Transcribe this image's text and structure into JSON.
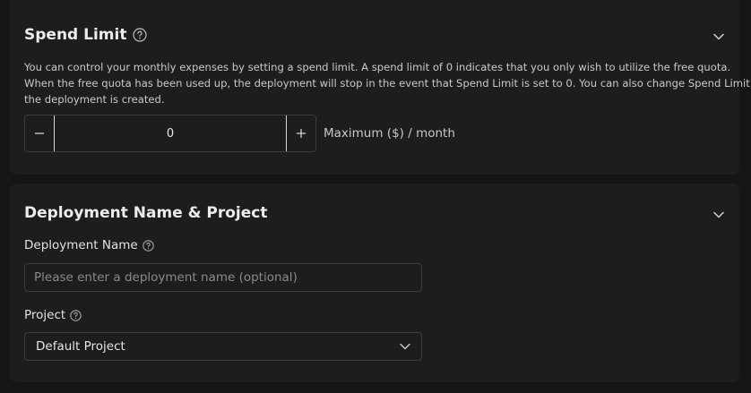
{
  "spend_limit": {
    "title": "Spend Limit",
    "description_lines": [
      "You can control your monthly expenses by setting a spend limit. A spend limit of 0 indicates that you only wish to utilize the free quota.",
      "When the free quota has been used up, the deployment will stop in the event that Spend Limit is set to 0. You can also change Spend Limit after",
      "the deployment is created."
    ],
    "decrement_symbol": "−",
    "increment_symbol": "+",
    "value": "0",
    "suffix": "Maximum ($) / month"
  },
  "deployment": {
    "title": "Deployment Name & Project",
    "name_label": "Deployment Name",
    "name_placeholder": "Please enter a deployment name (optional)",
    "name_value": "",
    "project_label": "Project",
    "project_selected": "Default Project"
  },
  "colors": {
    "background": "#151515",
    "card": "#1d1d1d",
    "border": "#3c3c3c",
    "text": "#e6e6e6",
    "muted": "#c9c9c9"
  },
  "icons": {
    "help": "question-circle",
    "collapse": "chevron-down",
    "select": "chevron-down"
  }
}
